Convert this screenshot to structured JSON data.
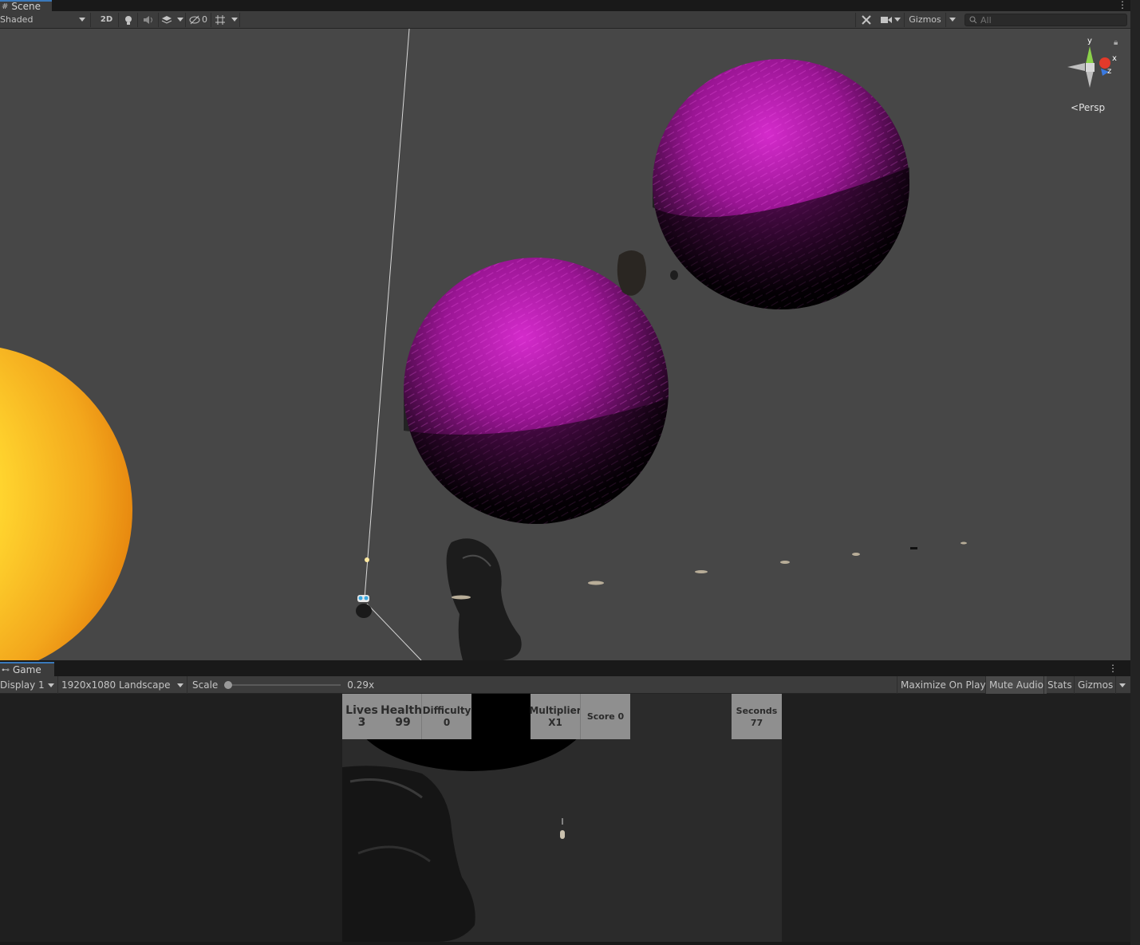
{
  "scene": {
    "tab_label": "Scene",
    "shading_mode": "Shaded",
    "btn_2d": "2D",
    "hidden_count": "0",
    "gizmos_label": "Gizmos",
    "search_placeholder": "All",
    "projection_label": "Persp",
    "axis_y": "y",
    "axis_x": "x",
    "axis_z": "z"
  },
  "game": {
    "tab_label": "Game",
    "display": "Display 1",
    "resolution": "1920x1080 Landscape",
    "scale_label": "Scale",
    "scale_value": "0.29x",
    "scale_fraction": 0.0,
    "buttons": [
      "Maximize On Play",
      "Mute Audio",
      "Stats",
      "Gizmos"
    ]
  },
  "hud": {
    "lives_label": "Lives",
    "lives_value": "3",
    "health_label": "Health",
    "health_value": "99",
    "difficulty_label": "Difficulty",
    "difficulty_value": "0",
    "multiplier_label": "Multiplier",
    "multiplier_value": "X1",
    "score_text": "Score 0",
    "seconds_label": "Seconds",
    "seconds_value": "77"
  },
  "colors": {
    "panel": "#3c3c3c",
    "viewport": "#474747",
    "planet_purple": "#c21cb8",
    "sun_yellow": "#ffd94a",
    "hud_bg": "#8f8f8f",
    "active_tab_accent": "#3a79bb"
  }
}
